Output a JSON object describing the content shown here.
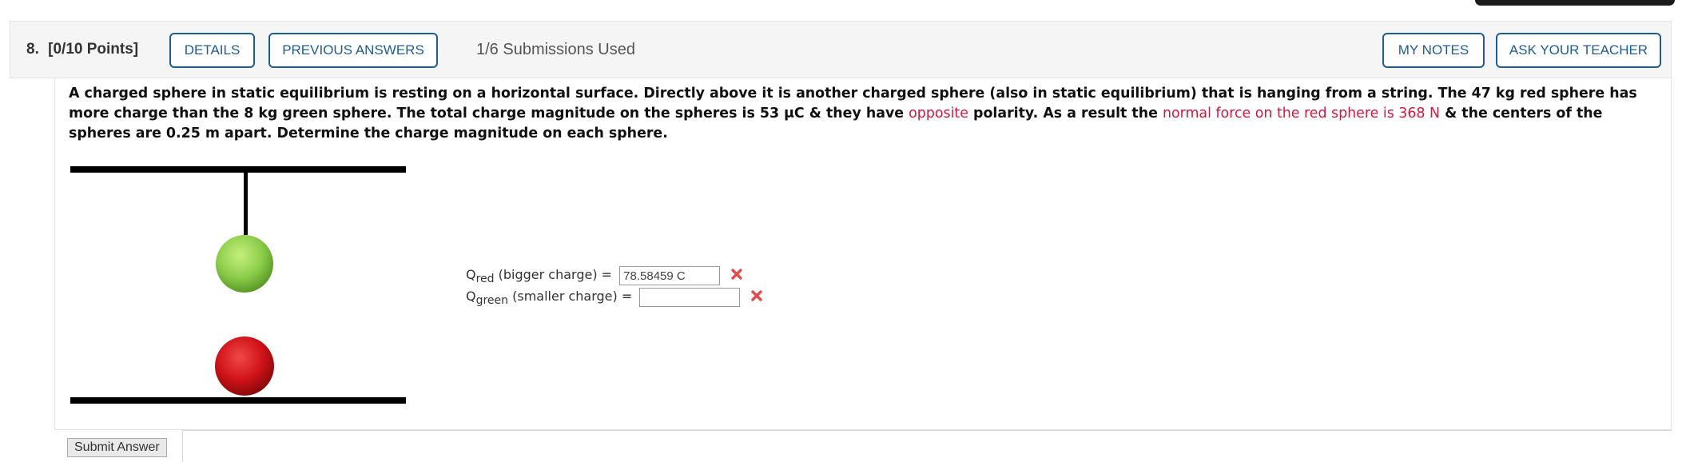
{
  "header": {
    "question_number": "8.",
    "points": "[0/10 Points]",
    "details_label": "DETAILS",
    "previous_answers_label": "PREVIOUS ANSWERS",
    "submissions": "1/6 Submissions Used",
    "my_notes_label": "MY NOTES",
    "ask_teacher_label": "ASK YOUR TEACHER"
  },
  "question": {
    "text_1": "A charged sphere in static equilibrium is resting on a horizontal surface. Directly above it is another charged sphere (also in static equilibrium) that is hanging from a string. The 47 kg red sphere has more charge than the 8 kg green sphere. The total charge magnitude on the spheres is 53 μC & they have ",
    "highlight_1": "opposite",
    "text_2": " polarity. As a result the ",
    "highlight_2": "normal force on the red sphere is 368 N",
    "text_3": " & the centers of the spheres are 0.25 m apart. Determine the charge magnitude on each sphere."
  },
  "answers": {
    "red": {
      "q": "Q",
      "sub": "red",
      "label": " (bigger charge) =",
      "value": "78.58459 C",
      "status_icon": "x-mark-icon"
    },
    "green": {
      "q": "Q",
      "sub": "green",
      "label": " (smaller charge) =",
      "value": "",
      "status_icon": "x-mark-icon"
    }
  },
  "colors": {
    "button_border": "#1f5c91",
    "highlight": "#d11a3f",
    "red_sphere": "#d4141b",
    "green_sphere": "#8ccd4a",
    "error_x": "#e24b4b"
  },
  "submit_label": "Submit Answer"
}
